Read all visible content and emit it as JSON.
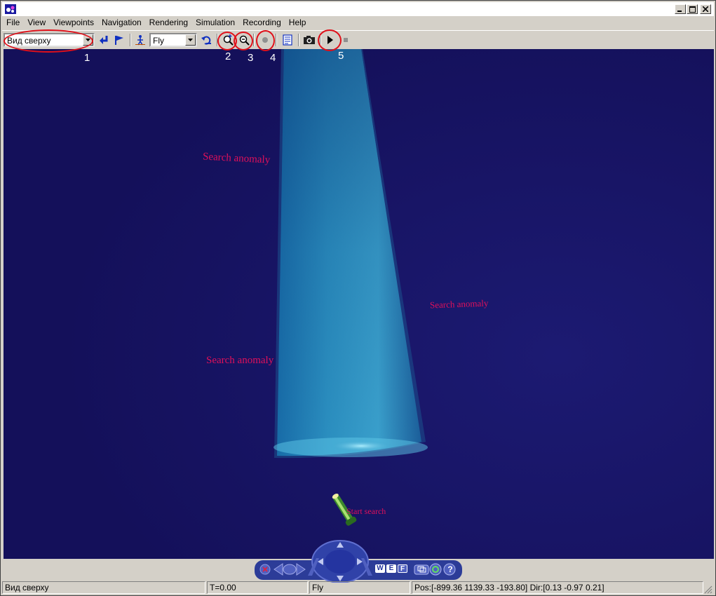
{
  "window": {
    "icon": "vrml-player-icon",
    "controls": [
      "minimize-icon",
      "maximize-icon",
      "close-icon"
    ]
  },
  "menubar": {
    "items": [
      {
        "label": "File"
      },
      {
        "label": "View"
      },
      {
        "label": "Viewpoints"
      },
      {
        "label": "Navigation"
      },
      {
        "label": "Rendering"
      },
      {
        "label": "Simulation"
      },
      {
        "label": "Recording"
      },
      {
        "label": "Help"
      }
    ]
  },
  "toolbar": {
    "viewpoint_value": "Вид сверху",
    "nav_mode_value": "Fly",
    "icons": [
      "return-arrow-icon",
      "flag-icon",
      "walk-icon",
      "undo-icon",
      "zoom-in-icon",
      "zoom-out-icon",
      "record-icon",
      "notes-icon",
      "camera-icon",
      "play-icon",
      "stop-icon"
    ]
  },
  "annotations": {
    "ring_color": "#e0101a",
    "labels": [
      "1",
      "2",
      "3",
      "4",
      "5"
    ]
  },
  "scene": {
    "background_color": "#14105a",
    "beam_color": "#2b8fc0",
    "label_color": "#e0105a",
    "labels": [
      "Search anomaly",
      "Search anomaly",
      "Search anomaly",
      "Start search"
    ]
  },
  "navigator": {
    "buttons": [
      "W",
      "E",
      "F"
    ],
    "icons": [
      "close-icon",
      "left-arrow-icon",
      "orbit-icon",
      "right-arrow-icon",
      "direction-pad-icon",
      "windows-icon",
      "settings-icon",
      "help-icon"
    ]
  },
  "statusbar": {
    "viewpoint": "Вид сверху",
    "time": "T=0.00",
    "mode": "Fly",
    "position": "Pos:[-899.36 1139.33 -193.80] Dir:[0.13 -0.97 0.21]"
  }
}
